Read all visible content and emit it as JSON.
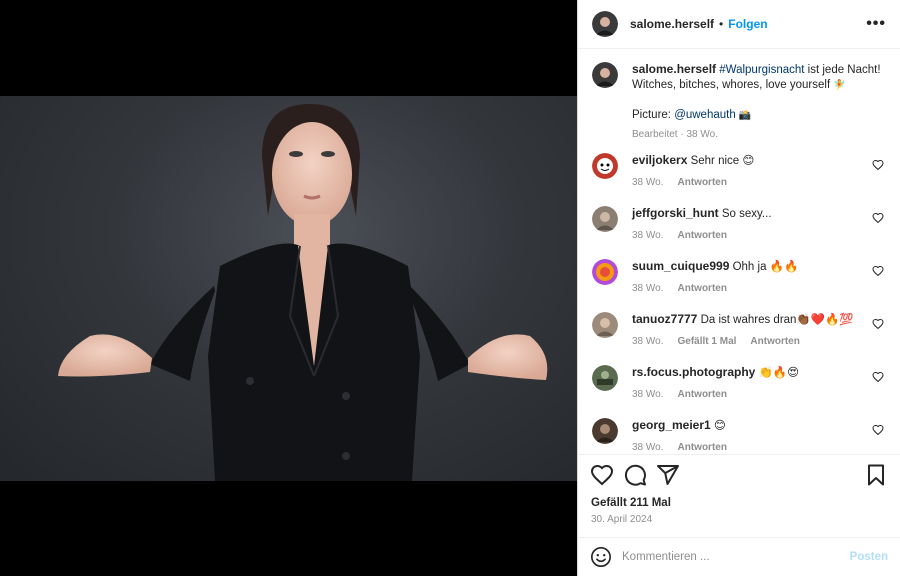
{
  "post": {
    "author": "salome.herself",
    "separator": "•",
    "follow_label": "Folgen",
    "more_label": "•••"
  },
  "caption": {
    "username": "salome.herself",
    "hashtag": "#Walpurgisnacht",
    "text_after_hashtag": " ist jede Nacht!",
    "line2": "Witches, bitches, whores, love yourself",
    "line2_emoji": "🧚",
    "picture_label": "Picture: ",
    "mention": "@uwehauth",
    "mention_suffix": " 📸",
    "edited": "Bearbeitet",
    "edited_sep": " · ",
    "time": "38 Wo."
  },
  "comments": [
    {
      "username": "eviljokerx",
      "text": "Sehr nice 😊",
      "time": "38 Wo.",
      "likes": "",
      "reply": "Antworten",
      "avatar_color": "#c0392b"
    },
    {
      "username": "jeffgorski_hunt",
      "text": "So sexy...",
      "time": "38 Wo.",
      "likes": "",
      "reply": "Antworten",
      "avatar_color": "#8a7f72"
    },
    {
      "username": "suum_cuique999",
      "text": "Ohh ja 🔥🔥",
      "time": "38 Wo.",
      "likes": "",
      "reply": "Antworten",
      "avatar_color": "#b44ad8"
    },
    {
      "username": "tanuoz7777",
      "text": "Da ist wahres dran👏🏾❤️🔥💯",
      "time": "38 Wo.",
      "likes": "Gefällt 1 Mal",
      "reply": "Antworten",
      "avatar_color": "#9c8b7a"
    },
    {
      "username": "rs.focus.photography",
      "text": "👏🔥😍",
      "time": "38 Wo.",
      "likes": "",
      "reply": "Antworten",
      "avatar_color": "#5a6b4f"
    },
    {
      "username": "georg_meier1",
      "text": "😊",
      "time": "38 Wo.",
      "likes": "",
      "reply": "Antworten",
      "avatar_color": "#4a3a30"
    }
  ],
  "stats": {
    "likes": "Gefällt 211 Mal",
    "date": "30. April 2024"
  },
  "composer": {
    "placeholder": "Kommentieren ...",
    "post_label": "Posten"
  },
  "colors": {
    "accent": "#0095f6",
    "link": "#00376b",
    "muted": "#8e8e8e"
  }
}
